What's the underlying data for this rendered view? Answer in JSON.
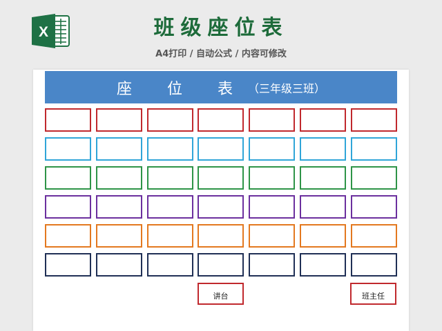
{
  "header": {
    "title": "班级座位表",
    "subtitle": "A4打印 / 自动公式 / 内容可修改",
    "logo_icon": "excel-icon",
    "logo_letter": "X"
  },
  "sheet": {
    "banner_main": "座 位 表",
    "banner_sub": "（三年级三班）",
    "seats_per_row": 7,
    "row_colors": [
      "#c0282d",
      "#2fa5d8",
      "#2e9447",
      "#6b2f9e",
      "#e3781f",
      "#1f2f55"
    ],
    "podium_label": "讲台",
    "teacher_label": "班主任",
    "desk_border_color": "#c0282d",
    "banner_color": "#4a86c8"
  }
}
